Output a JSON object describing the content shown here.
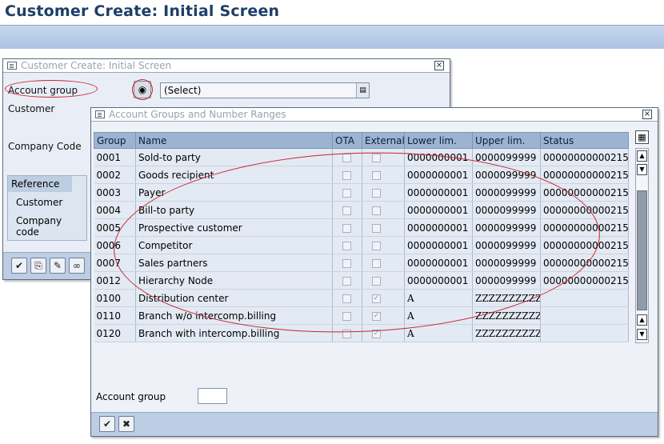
{
  "window": {
    "title": "Customer Create: Initial Screen"
  },
  "dialog1": {
    "title": "Customer Create: Initial Screen",
    "close_glyph": "×",
    "fields": {
      "account_group_label": "Account group",
      "account_group_value": "(Select)",
      "customer_label": "Customer",
      "company_code_label": "Company Code"
    },
    "reference": {
      "header": "Reference",
      "customer_label": "Customer",
      "company_code_label": "Company code"
    }
  },
  "dialog2": {
    "title": "Account Groups and Number Ranges",
    "close_glyph": "×",
    "columns": [
      "Group",
      "Name",
      "OTA",
      "External",
      "Lower lim.",
      "Upper lim.",
      "Status"
    ],
    "rows": [
      {
        "group": "0001",
        "name": "Sold-to party",
        "ota": false,
        "external": false,
        "lower": "0000000001",
        "upper": "0000099999",
        "status": "00000000000215"
      },
      {
        "group": "0002",
        "name": "Goods recipient",
        "ota": false,
        "external": false,
        "lower": "0000000001",
        "upper": "0000099999",
        "status": "00000000000215"
      },
      {
        "group": "0003",
        "name": "Payer",
        "ota": false,
        "external": false,
        "lower": "0000000001",
        "upper": "0000099999",
        "status": "00000000000215"
      },
      {
        "group": "0004",
        "name": "Bill-to party",
        "ota": false,
        "external": false,
        "lower": "0000000001",
        "upper": "0000099999",
        "status": "00000000000215"
      },
      {
        "group": "0005",
        "name": "Prospective customer",
        "ota": false,
        "external": false,
        "lower": "0000000001",
        "upper": "0000099999",
        "status": "00000000000215"
      },
      {
        "group": "0006",
        "name": "Competitor",
        "ota": false,
        "external": false,
        "lower": "0000000001",
        "upper": "0000099999",
        "status": "00000000000215"
      },
      {
        "group": "0007",
        "name": "Sales partners",
        "ota": false,
        "external": false,
        "lower": "0000000001",
        "upper": "0000099999",
        "status": "00000000000215"
      },
      {
        "group": "0012",
        "name": "Hierarchy Node",
        "ota": false,
        "external": false,
        "lower": "0000000001",
        "upper": "0000099999",
        "status": "00000000000215"
      },
      {
        "group": "0100",
        "name": "Distribution center",
        "ota": false,
        "external": true,
        "lower": "A",
        "upper": "ZZZZZZZZZZ",
        "status": ""
      },
      {
        "group": "0110",
        "name": "Branch w/o intercomp.billing",
        "ota": false,
        "external": true,
        "lower": "A",
        "upper": "ZZZZZZZZZZ",
        "status": ""
      },
      {
        "group": "0120",
        "name": "Branch with intercomp.billing",
        "ota": false,
        "external": true,
        "lower": "A",
        "upper": "ZZZZZZZZZZ",
        "status": ""
      }
    ],
    "account_group_label": "Account group",
    "account_group_value": ""
  },
  "colors": {
    "title": "#1d3e66",
    "annotation": "#c8242c",
    "header": "#9db3d2",
    "toolbar": "#bccde4"
  }
}
